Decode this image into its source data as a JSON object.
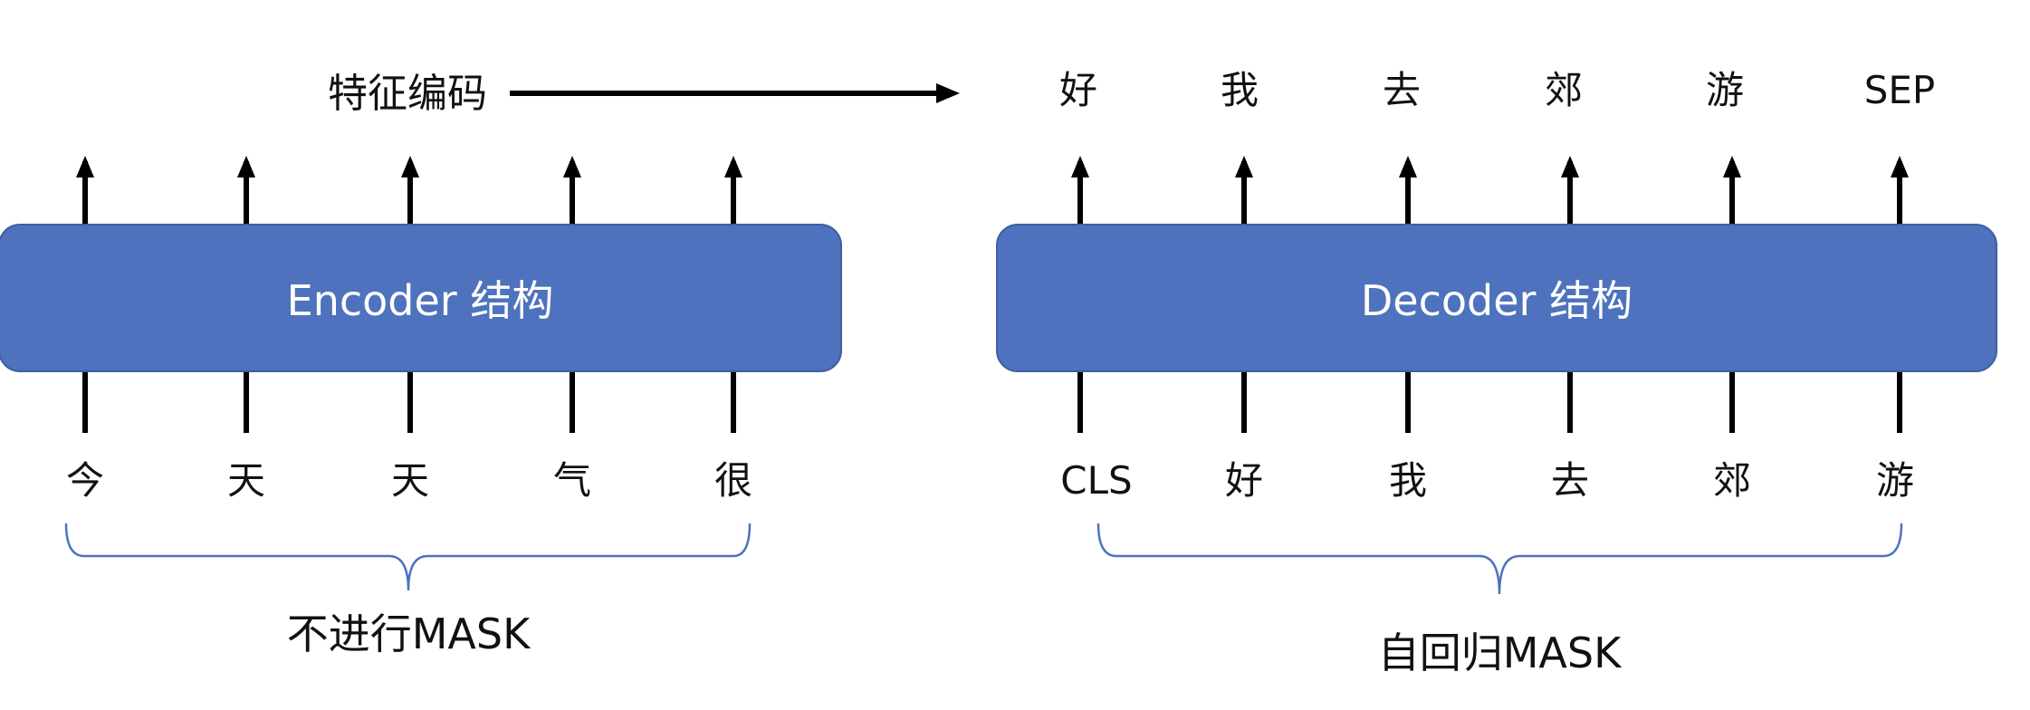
{
  "encoder": {
    "label": "Encoder 结构",
    "inputs": [
      "今",
      "天",
      "天",
      "气",
      "很"
    ],
    "bracket_caption": "不进行MASK"
  },
  "decoder": {
    "label": "Decoder 结构",
    "inputs": [
      "CLS",
      "好",
      "我",
      "去",
      "郊",
      "游"
    ],
    "outputs": [
      "好",
      "我",
      "去",
      "郊",
      "游",
      "SEP"
    ],
    "bracket_caption": "自回归MASK"
  },
  "feature_label": "特征编码",
  "colors": {
    "box_fill": "#4e72bd",
    "box_border": "#3f5f9f",
    "box_text": "#ffffff",
    "bracket": "#4e72bd",
    "line": "#000000"
  }
}
